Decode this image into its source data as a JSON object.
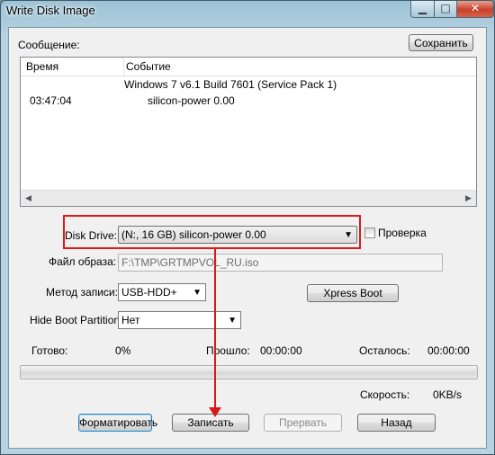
{
  "window": {
    "title": "Write Disk Image",
    "min_symbol": "▁",
    "max_symbol": "□",
    "close_symbol": "✕"
  },
  "message": {
    "label": "Сообщение:",
    "save_button": "Сохранить"
  },
  "log": {
    "columns": [
      "Время",
      "Событие"
    ],
    "rows": [
      {
        "time": "",
        "event": "Windows 7 v6.1 Build 7601 (Service Pack 1)"
      },
      {
        "time": "03:47:04",
        "event": "silicon-power   0.00"
      }
    ]
  },
  "disk_drive": {
    "label": "Disk Drive:",
    "value": "(N:, 16 GB)        silicon-power   0.00",
    "verify_label": "Проверка",
    "verify_checked": false
  },
  "image_file": {
    "label": "Файл образа:",
    "value": "F:\\TMP\\GRTMPVOL_RU.iso"
  },
  "write_method": {
    "label": "Метод записи:",
    "value": "USB-HDD+",
    "xpress_boot_button": "Xpress Boot"
  },
  "hide_boot": {
    "label": "Hide Boot Partition:",
    "value": "Нет"
  },
  "status": {
    "done_label": "Готово:",
    "done_value": "0%",
    "elapsed_label": "Прошло:",
    "elapsed_value": "00:00:00",
    "remaining_label": "Осталось:",
    "remaining_value": "00:00:00",
    "speed_label": "Скорость:",
    "speed_value": "0KB/s",
    "progress_fraction": 0
  },
  "buttons": {
    "format": "Форматировать",
    "write": "Записать",
    "abort": "Прервать",
    "back": "Назад"
  },
  "colors": {
    "highlight": "#e01818"
  },
  "icons": {
    "dropdown": "▼",
    "scroll_left": "◀",
    "scroll_right": "▶"
  }
}
